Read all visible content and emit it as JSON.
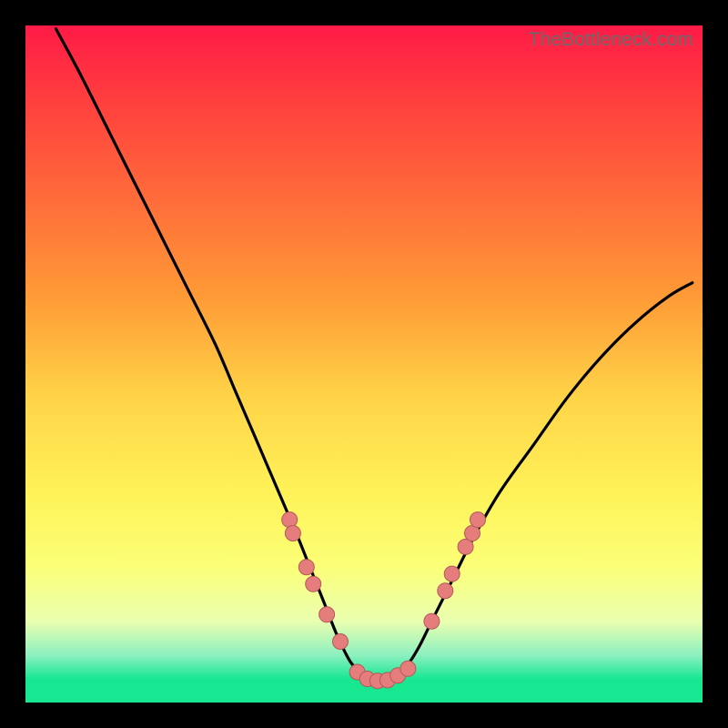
{
  "watermark": "TheBottleneck.com",
  "colors": {
    "gradient_top": "#ff1a46",
    "gradient_mid": "#fff45a",
    "gradient_bottom": "#18e792",
    "curve": "#000000",
    "dots_fill": "#e67d7d",
    "dots_stroke": "#b25a5a",
    "frame": "#000000"
  },
  "chart_data": {
    "type": "line",
    "title": "",
    "xlabel": "",
    "ylabel": "",
    "xlim": [
      0,
      100
    ],
    "ylim": [
      0,
      100
    ],
    "grid": false,
    "series": [
      {
        "name": "bottleneck-curve",
        "x": [
          4.5,
          8,
          12,
          16,
          20,
          24,
          28,
          31,
          34,
          37,
          40,
          42,
          44,
          46,
          48,
          50,
          52,
          54,
          56,
          58,
          60,
          63,
          66,
          70,
          75,
          80,
          85,
          90,
          95,
          98.5
        ],
        "y": [
          99.5,
          93,
          85,
          77,
          69,
          61,
          53,
          46,
          39,
          32,
          25,
          20,
          15,
          10,
          6,
          4,
          3,
          3.5,
          5,
          8,
          12,
          18,
          24,
          31,
          38,
          45,
          51,
          56,
          60,
          62
        ],
        "note": "Asymmetric V-shaped curve; y read as percent of vertical plot height from the bottom, x as percent of horizontal width from left. Values eyeballed from the image."
      }
    ],
    "markers": [
      {
        "name": "left-cluster",
        "x": 39.0,
        "y": 27.0
      },
      {
        "name": "left-cluster",
        "x": 39.5,
        "y": 25.0
      },
      {
        "name": "left-cluster",
        "x": 41.5,
        "y": 20.0
      },
      {
        "name": "left-cluster",
        "x": 42.5,
        "y": 17.5
      },
      {
        "name": "left-cluster",
        "x": 44.5,
        "y": 13.0
      },
      {
        "name": "left-cluster",
        "x": 46.5,
        "y": 9.0
      },
      {
        "name": "bottom-flat",
        "x": 49.0,
        "y": 4.5
      },
      {
        "name": "bottom-flat",
        "x": 50.5,
        "y": 3.5
      },
      {
        "name": "bottom-flat",
        "x": 52.0,
        "y": 3.2
      },
      {
        "name": "bottom-flat",
        "x": 53.5,
        "y": 3.3
      },
      {
        "name": "bottom-flat",
        "x": 55.0,
        "y": 4.0
      },
      {
        "name": "bottom-flat",
        "x": 56.5,
        "y": 5.0
      },
      {
        "name": "right-cluster",
        "x": 60.0,
        "y": 12.0
      },
      {
        "name": "right-cluster",
        "x": 62.0,
        "y": 16.5
      },
      {
        "name": "right-cluster",
        "x": 63.0,
        "y": 19.0
      },
      {
        "name": "right-cluster",
        "x": 65.0,
        "y": 23.0
      },
      {
        "name": "right-cluster",
        "x": 66.0,
        "y": 25.0
      },
      {
        "name": "right-cluster",
        "x": 66.8,
        "y": 27.0
      }
    ]
  }
}
